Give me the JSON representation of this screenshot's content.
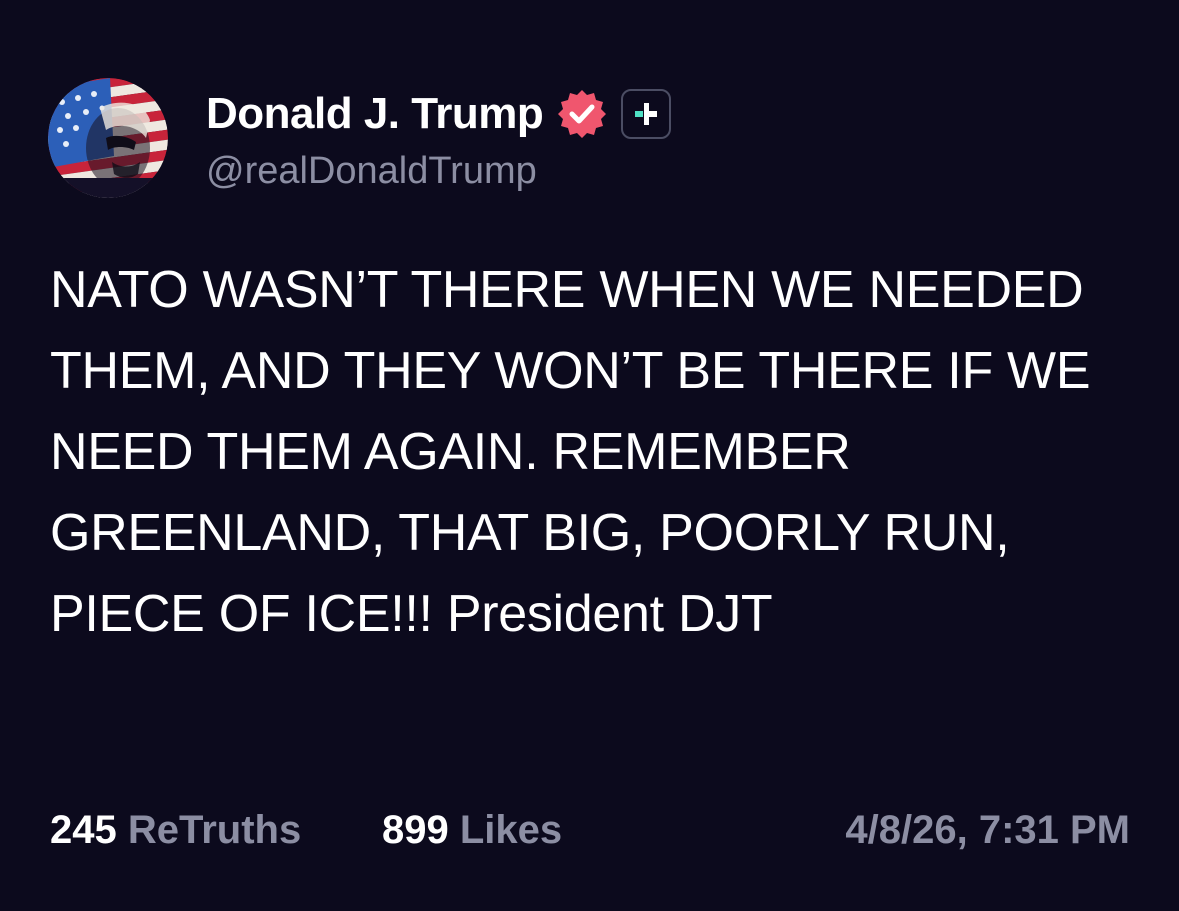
{
  "post": {
    "author": {
      "display_name": "Donald J. Trump",
      "handle": "@realDonaldTrump",
      "verified_icon": "verified-badge-icon",
      "plus_icon": "plus-badge-icon",
      "avatar": "avatar-flag-portrait"
    },
    "text": "NATO WASN’T THERE WHEN WE NEEDED THEM, AND THEY WON’T BE THERE IF WE NEED THEM AGAIN. REMEMBER GREENLAND, THAT BIG, POORLY RUN, PIECE OF ICE!!! President DJT",
    "stats": {
      "retruths_count": "245",
      "retruths_label": "ReTruths",
      "likes_count": "899",
      "likes_label": "Likes"
    },
    "timestamp": "4/8/26, 7:31 PM"
  },
  "colors": {
    "background": "#0c0a1d",
    "text": "#ffffff",
    "muted": "#8c8ea3",
    "verified": "#f0566e",
    "plus_accent": "#4fe0c4"
  }
}
